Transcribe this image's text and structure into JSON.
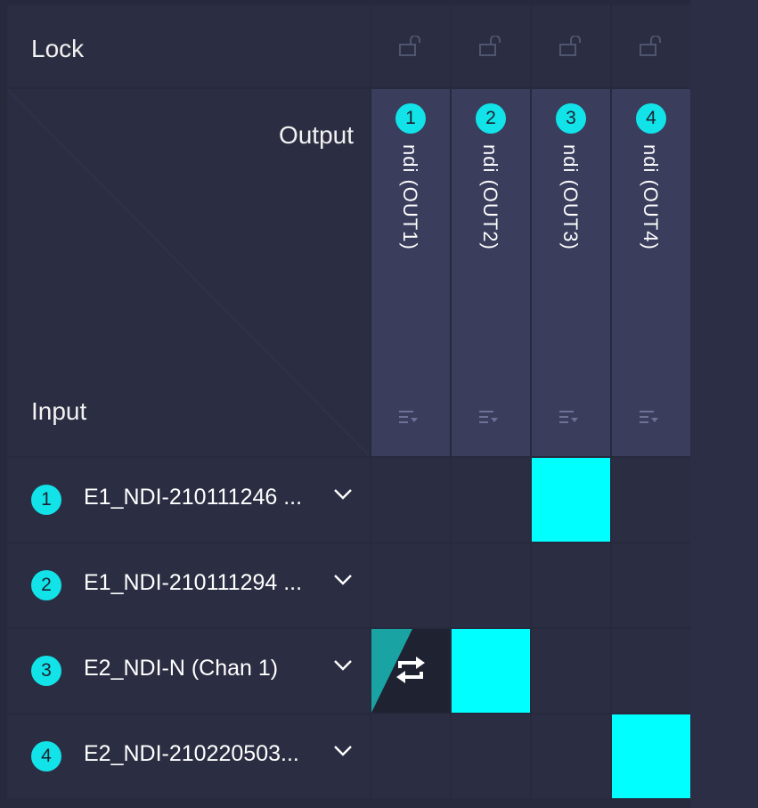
{
  "header": {
    "lock_label": "Lock",
    "output_label": "Output",
    "input_label": "Input"
  },
  "outputs": [
    {
      "number": "1",
      "name": "ndi (OUT1)",
      "locked": false
    },
    {
      "number": "2",
      "name": "ndi (OUT2)",
      "locked": false
    },
    {
      "number": "3",
      "name": "ndi (OUT3)",
      "locked": false
    },
    {
      "number": "4",
      "name": "ndi (OUT4)",
      "locked": false
    }
  ],
  "inputs": [
    {
      "number": "1",
      "name": "E1_NDI-210111246 ..."
    },
    {
      "number": "2",
      "name": "E1_NDI-210111294 ..."
    },
    {
      "number": "3",
      "name": "E2_NDI-N (Chan 1)"
    },
    {
      "number": "4",
      "name": "E2_NDI-210220503..."
    }
  ],
  "routing": [
    [
      "off",
      "off",
      "on",
      "off"
    ],
    [
      "off",
      "off",
      "off",
      "off"
    ],
    [
      "pending",
      "on",
      "off",
      "off"
    ],
    [
      "off",
      "off",
      "off",
      "on"
    ]
  ],
  "colors": {
    "accent": "#00ffff",
    "badge": "#11e3e8",
    "background": "#272a3d",
    "output_header": "#3a3d5c"
  },
  "icons": {
    "lock": "unlock-icon",
    "output_menu": "list-filter-icon",
    "input_dropdown": "chevron-down-icon",
    "pending_switch": "swap-icon"
  }
}
